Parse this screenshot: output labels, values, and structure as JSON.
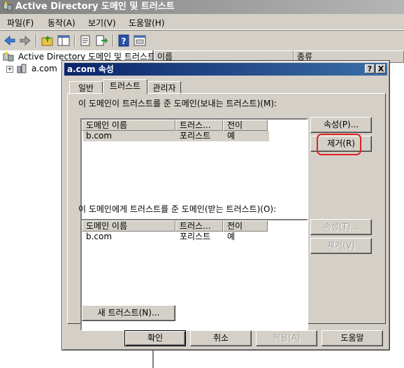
{
  "window": {
    "title": "Active Directory 도메인 및 트러스트"
  },
  "menu": [
    {
      "label": "파일(F)"
    },
    {
      "label": "동작(A)"
    },
    {
      "label": "보기(V)"
    },
    {
      "label": "도움말(H)"
    }
  ],
  "toolbar_icons": [
    "back-arrow-icon",
    "forward-arrow-icon",
    "up-folder-icon",
    "show-hide-tree-icon",
    "properties-icon",
    "export-list-icon",
    "help-icon",
    "view-icon"
  ],
  "tree": {
    "root_label": "Active Directory 도메인 및 트러스트",
    "child_label": "a.com"
  },
  "list_pane": {
    "columns": [
      "이름",
      "종류"
    ]
  },
  "dialog": {
    "title": "a.com 속성",
    "help_btn": "?",
    "close_btn": "X",
    "tabs": [
      {
        "label": "일반",
        "active": false
      },
      {
        "label": "트러스트",
        "active": true
      },
      {
        "label": "관리자",
        "active": false
      }
    ],
    "outgoing": {
      "label": "이 도메인이 트러스트를 준 도메인(보내는 트러스트)(M):",
      "columns": [
        "도메인 이름",
        "트러스...",
        "전이"
      ],
      "rows": [
        {
          "domain": "b.com",
          "type": "포리스트",
          "transitive": "예",
          "selected": true
        }
      ],
      "properties_btn": "속성(P)...",
      "remove_btn": "제거(R)"
    },
    "incoming": {
      "label": "이 도메인에게 트러스트를 준 도메인(받는 트러스트)(O):",
      "columns": [
        "도메인 이름",
        "트러스...",
        "전이"
      ],
      "rows": [
        {
          "domain": "b.com",
          "type": "포리스트",
          "transitive": "예",
          "selected": false
        }
      ],
      "properties_btn": "속성(T)...",
      "remove_btn": "제거(V)"
    },
    "new_trust_btn": "새 트러스트(N)...",
    "ok_btn": "확인",
    "cancel_btn": "취소",
    "apply_btn": "적용(A)",
    "help_label": "도움말"
  },
  "colors": {
    "dialog_title_start": "#0a246a",
    "dialog_title_end": "#3a6ea5",
    "annotation": "#e02020",
    "face": "#d4d0c8"
  }
}
